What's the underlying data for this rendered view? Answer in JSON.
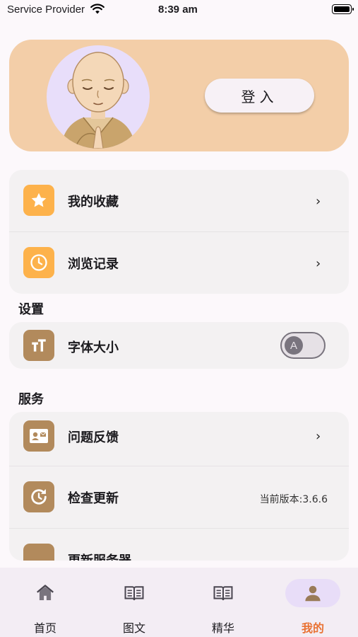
{
  "status": {
    "carrier": "Service Provider",
    "time": "8:39 am"
  },
  "hero": {
    "login_label": "登入"
  },
  "menu": [
    {
      "label": "我的收藏",
      "icon": "star-icon"
    },
    {
      "label": "浏览记录",
      "icon": "clock-icon"
    }
  ],
  "settings": {
    "title": "设置",
    "font_size_label": "字体大小",
    "toggle_letter": "A"
  },
  "services": {
    "title": "服务",
    "feedback_label": "问题反馈",
    "check_update_label": "检查更新",
    "version_text": "当前版本:3.6.6",
    "update_server_label": "更新服务器"
  },
  "nav": [
    {
      "label": "首页",
      "icon": "home-icon"
    },
    {
      "label": "图文",
      "icon": "book-icon"
    },
    {
      "label": "精华",
      "icon": "book-icon"
    },
    {
      "label": "我的",
      "icon": "person-icon",
      "active": true
    }
  ],
  "colors": {
    "hero": "#f3cea8",
    "accent": "#e97233",
    "orange_icon": "#fdb24b",
    "brown_icon": "#b28a5c"
  }
}
